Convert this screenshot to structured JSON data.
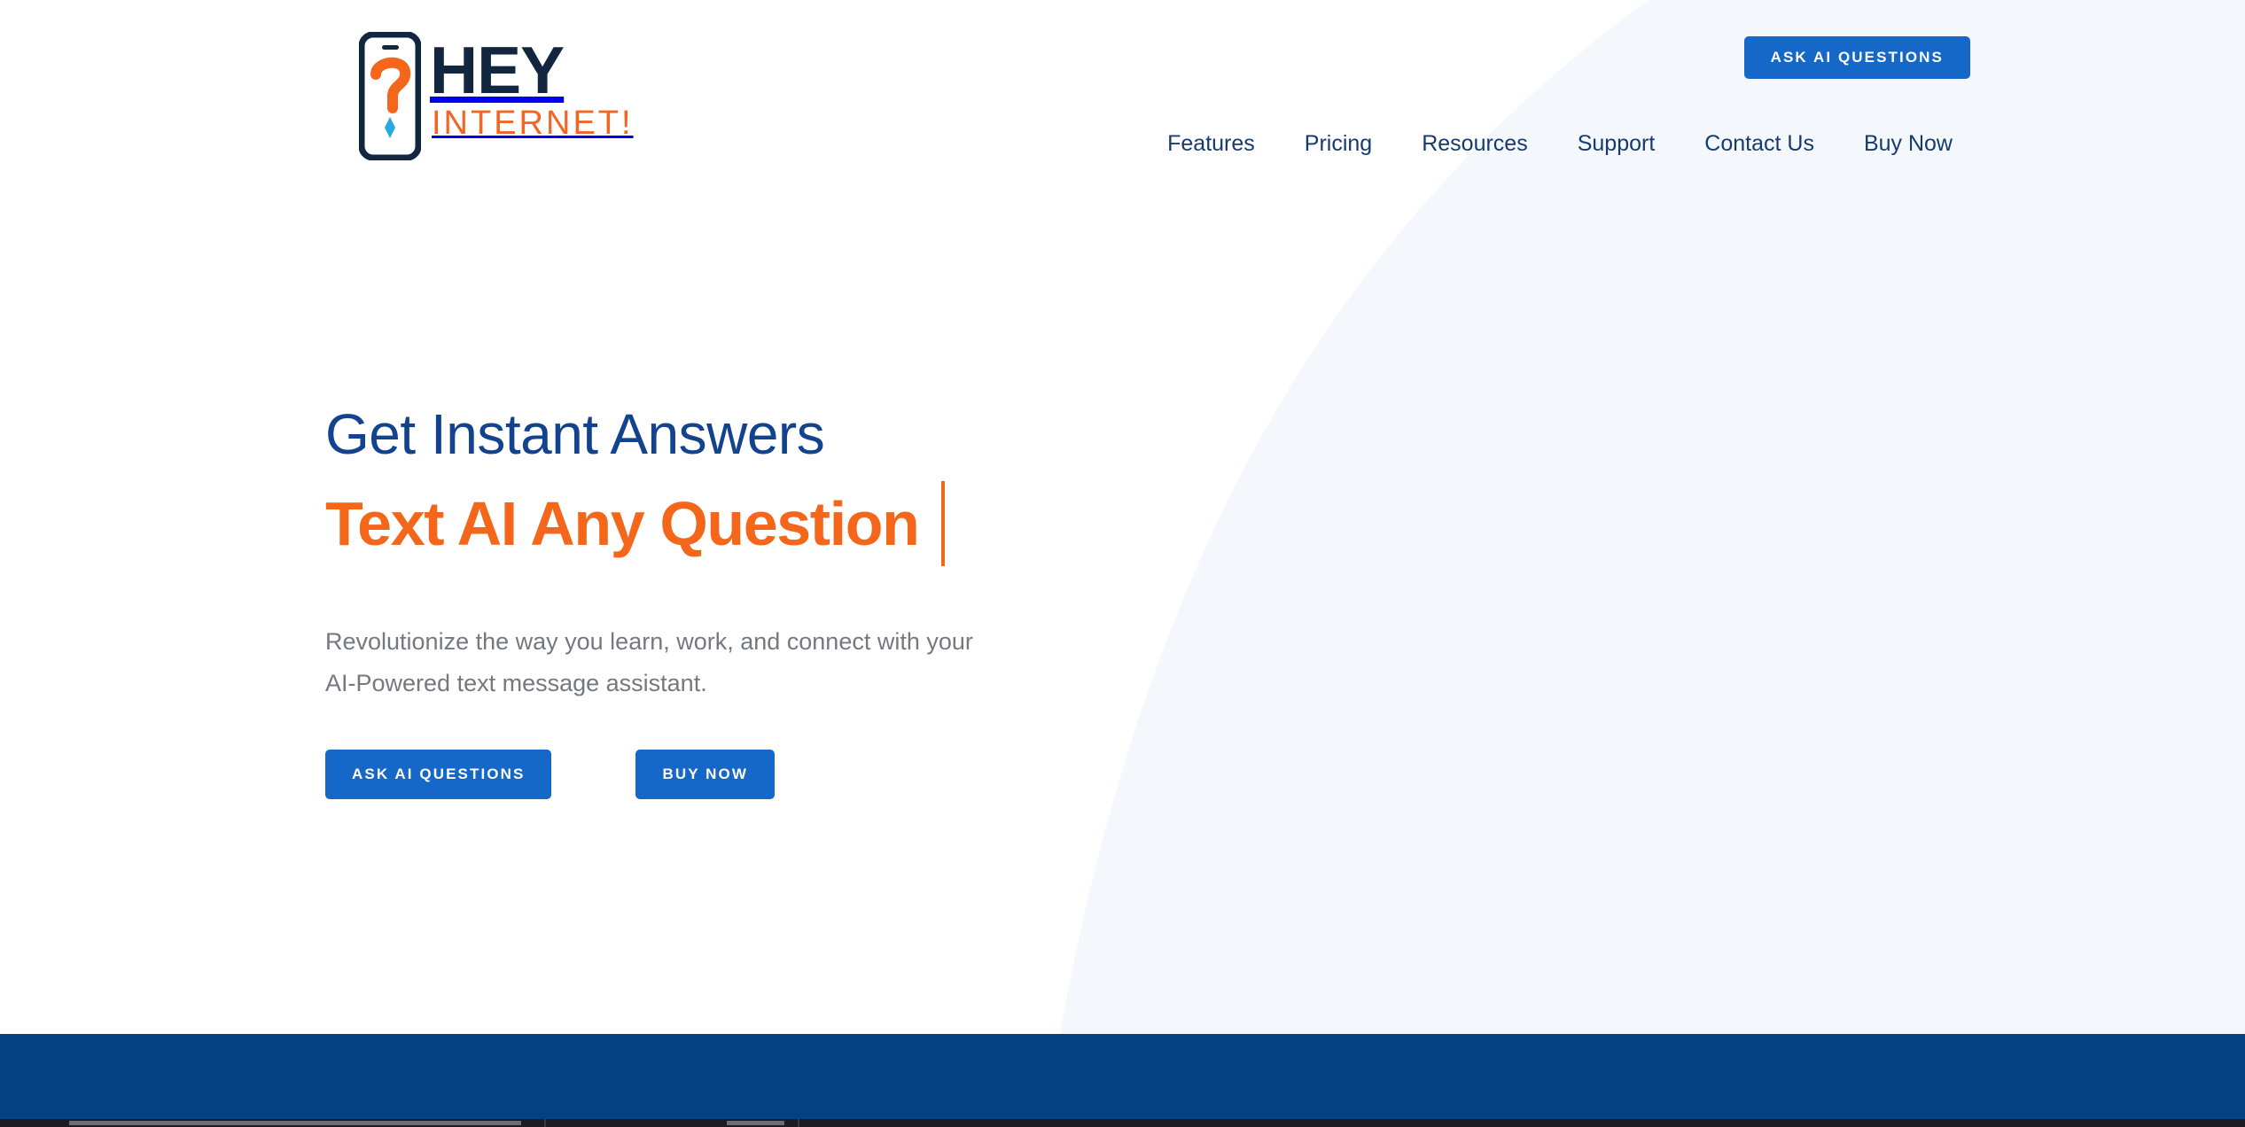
{
  "brand": {
    "name_top": "HEY",
    "name_bottom": "INTERNET!",
    "icon": "phone-question-icon",
    "navy": "#12263f",
    "orange": "#f26522",
    "cyan": "#29abe2"
  },
  "header": {
    "cta_label": "ASK AI QUESTIONS",
    "nav": [
      {
        "label": "Features"
      },
      {
        "label": "Pricing"
      },
      {
        "label": "Resources"
      },
      {
        "label": "Support"
      },
      {
        "label": "Contact Us"
      },
      {
        "label": "Buy Now"
      }
    ]
  },
  "hero": {
    "headline_top": "Get Instant Answers",
    "headline_typed": "Text AI Any Question",
    "subtext": "Revolutionize the way you learn, work, and connect with your AI-Powered text message assistant.",
    "cta_primary": "ASK AI QUESTIONS",
    "cta_secondary": "BUY NOW"
  },
  "colors": {
    "accent_blue": "#1568c8",
    "headline_navy": "#13438f",
    "headline_orange": "#f4671b",
    "nav_navy": "#173a6d",
    "subtext_gray": "#74797f",
    "band_navy": "#044084",
    "curve_tint": "#f4f8fc"
  }
}
